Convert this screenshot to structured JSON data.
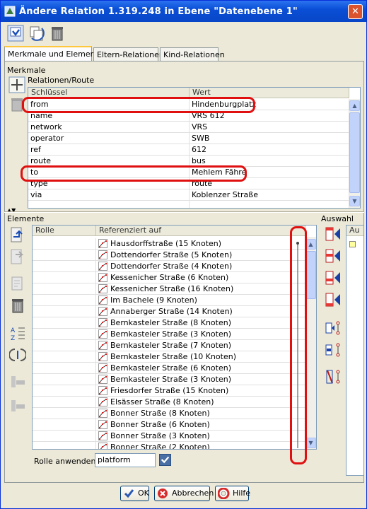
{
  "window": {
    "title": "Ändere Relation 1.319.248 in Ebene \"Datenebene 1\"",
    "close_label": "✕"
  },
  "tabs": [
    {
      "label": "Merkmale und Elemente",
      "active": true
    },
    {
      "label": "Eltern-Relationen",
      "active": false
    },
    {
      "label": "Kind-Relationen",
      "active": false
    }
  ],
  "merkmale": {
    "title": "Merkmale",
    "preset": "Relationen/Route",
    "col_key": "Schlüssel",
    "col_value": "Wert",
    "rows": [
      {
        "key": "from",
        "value": "Hindenburgplatz"
      },
      {
        "key": "name",
        "value": "VRS 612"
      },
      {
        "key": "network",
        "value": "VRS"
      },
      {
        "key": "operator",
        "value": "SWB"
      },
      {
        "key": "ref",
        "value": "612"
      },
      {
        "key": "route",
        "value": "bus"
      },
      {
        "key": "to",
        "value": "Mehlem Fähre"
      },
      {
        "key": "type",
        "value": "route"
      },
      {
        "key": "via",
        "value": "Koblenzer Straße"
      },
      {
        "key": "",
        "value": ""
      }
    ]
  },
  "elemente": {
    "title": "Elemente",
    "col_role": "Rolle",
    "col_ref": "Referenziert auf",
    "rows": [
      "Hausdorffstraße (15 Knoten)",
      "Dottendorfer Straße (5 Knoten)",
      "Dottendorfer Straße (4 Knoten)",
      "Kessenicher Straße (6 Knoten)",
      "Kessenicher Straße (16 Knoten)",
      "Im Bachele (9 Knoten)",
      "Annaberger Straße (14 Knoten)",
      "Bernkasteler Straße (8 Knoten)",
      "Bernkasteler Straße (3 Knoten)",
      "Bernkasteler Straße (7 Knoten)",
      "Bernkasteler Straße (10 Knoten)",
      "Bernkasteler Straße (6 Knoten)",
      "Bernkasteler Straße (3 Knoten)",
      "Friesdorfer Straße (15 Knoten)",
      "Elsässer Straße (8 Knoten)",
      "Bonner Straße (8 Knoten)",
      "Bonner Straße (6 Knoten)",
      "Bonner Straße (3 Knoten)",
      "Bonner Straße (2 Knoten)"
    ],
    "role_apply_label": "Rolle anwenden:",
    "role_value": "platform"
  },
  "auswahl": {
    "title": "Auswahl",
    "col": "Au"
  },
  "buttons": {
    "ok": "OK",
    "cancel": "Abbrechen",
    "help": "Hilfe"
  },
  "colors": {
    "highlight": "#e01010",
    "titlebar": "#0a4fd6"
  }
}
